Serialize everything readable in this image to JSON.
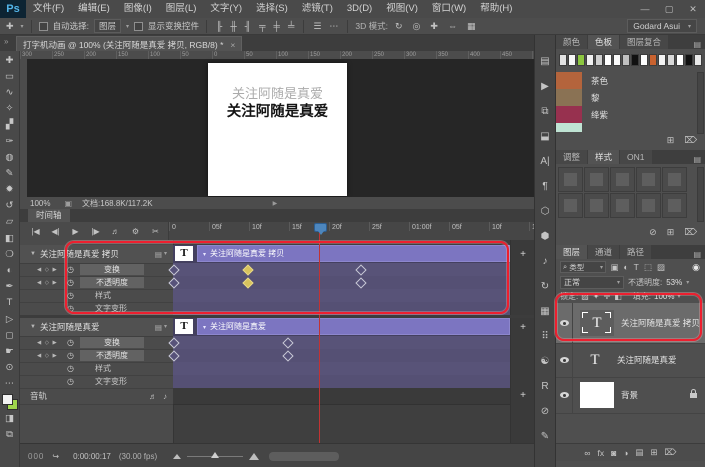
{
  "app": {
    "logo": "Ps",
    "window_controls": [
      {
        "g": "—"
      },
      {
        "g": "▢"
      },
      {
        "g": "✕"
      }
    ],
    "workspace": "Godard Asui",
    "collapse_glyph": "»"
  },
  "menubar": {
    "items": [
      {
        "label": "文件(F)"
      },
      {
        "label": "编辑(E)"
      },
      {
        "label": "图像(I)"
      },
      {
        "label": "图层(L)"
      },
      {
        "label": "文字(Y)"
      },
      {
        "label": "选择(S)"
      },
      {
        "label": "滤镜(T)"
      },
      {
        "label": "3D(D)"
      },
      {
        "label": "视图(V)"
      },
      {
        "label": "窗口(W)"
      },
      {
        "label": "帮助(H)"
      }
    ]
  },
  "options": {
    "tool_glyph": "✚",
    "auto_select_label": "自动选择:",
    "auto_select_value": "图层",
    "show_transform_label": "显示变换控件",
    "align_icons": [
      {
        "g": "╟"
      },
      {
        "g": "╫"
      },
      {
        "g": "╢"
      },
      {
        "g": "╤"
      },
      {
        "g": "╪"
      },
      {
        "g": "╧"
      }
    ],
    "dist_icons": [
      {
        "g": "☰"
      },
      {
        "g": "⋯"
      }
    ],
    "mode_label": "3D 模式:",
    "mode_icons": [
      {
        "g": "↻"
      },
      {
        "g": "◎"
      },
      {
        "g": "✚"
      },
      {
        "g": "⇔"
      },
      {
        "g": "▦"
      }
    ]
  },
  "tabbar": {
    "title": "打字机动画 @ 100% (关注阿随是真爱 拷贝, RGB/8) *",
    "close": "×"
  },
  "tools": [
    {
      "name": "move-tool-icon",
      "g": "✚"
    },
    {
      "name": "marquee-tool-icon",
      "g": "▭"
    },
    {
      "name": "lasso-tool-icon",
      "g": "∿"
    },
    {
      "name": "quick-selection-tool-icon",
      "g": "✧"
    },
    {
      "name": "crop-tool-icon",
      "g": "▞"
    },
    {
      "name": "eyedropper-tool-icon",
      "g": "✑"
    },
    {
      "name": "healing-brush-tool-icon",
      "g": "◍"
    },
    {
      "name": "brush-tool-icon",
      "g": "✎"
    },
    {
      "name": "clone-stamp-tool-icon",
      "g": "✹"
    },
    {
      "name": "history-brush-tool-icon",
      "g": "↺"
    },
    {
      "name": "eraser-tool-icon",
      "g": "▱"
    },
    {
      "name": "gradient-tool-icon",
      "g": "◧"
    },
    {
      "name": "blur-tool-icon",
      "g": "❍"
    },
    {
      "name": "dodge-tool-icon",
      "g": "◐"
    },
    {
      "name": "pen-tool-icon",
      "g": "✒"
    },
    {
      "name": "type-tool-icon",
      "g": "T"
    },
    {
      "name": "path-selection-tool-icon",
      "g": "▷"
    },
    {
      "name": "shape-tool-icon",
      "g": "◻"
    },
    {
      "name": "hand-tool-icon",
      "g": "☛"
    },
    {
      "name": "zoom-tool-icon",
      "g": "⊙"
    },
    {
      "name": "more-tools-icon",
      "g": "⋯"
    }
  ],
  "ruler": {
    "h_labels": [
      {
        "t": "300"
      },
      {
        "t": "250"
      },
      {
        "t": "200"
      },
      {
        "t": "150"
      },
      {
        "t": "100"
      },
      {
        "t": "50"
      },
      {
        "t": "0"
      },
      {
        "t": "50"
      },
      {
        "t": "100"
      },
      {
        "t": "150"
      },
      {
        "t": "200"
      },
      {
        "t": "250"
      },
      {
        "t": "300"
      },
      {
        "t": "350"
      },
      {
        "t": "400"
      },
      {
        "t": "450"
      },
      {
        "t": "500"
      }
    ]
  },
  "canvas": {
    "line1": "关注阿随是真爱",
    "line2": "关注阿随是真爱"
  },
  "statusbar": {
    "zoom": "100%",
    "doc_icon": "▣",
    "doc": "文档:168.8K/117.2K",
    "chevron": "▶"
  },
  "timeline": {
    "tab": "时间轴",
    "transport": [
      {
        "g": "|◀"
      },
      {
        "g": "◀|"
      },
      {
        "g": "▶"
      },
      {
        "g": "|▶"
      },
      {
        "g": "♬"
      },
      {
        "g": "⚙"
      },
      {
        "g": "✂"
      },
      {
        "g": "◪"
      }
    ],
    "ruler": [
      {
        "t": "0"
      },
      {
        "t": "05f"
      },
      {
        "t": "10f"
      },
      {
        "t": "15f"
      },
      {
        "t": "20f"
      },
      {
        "t": "25f"
      },
      {
        "t": "01:00f"
      },
      {
        "t": "05f"
      },
      {
        "t": "10f"
      },
      {
        "t": "15f"
      }
    ],
    "group_icon": "▤",
    "caret": "▼",
    "add": "+",
    "groups": [
      {
        "name": "关注阿随是真爱 拷贝",
        "clip": "关注阿随是真爱 拷贝",
        "thumb": "T",
        "rows": [
          {
            "label": "变换"
          },
          {
            "label": "不透明度"
          },
          {
            "label": "样式"
          },
          {
            "label": "文字变形"
          }
        ],
        "keys_transform": [
          {
            "css": "left:-3px",
            "cls": "kf"
          },
          {
            "css": "left:71px",
            "cls": "kf yellow"
          },
          {
            "css": "left:184px",
            "cls": "kf"
          }
        ],
        "keys_opacity": [
          {
            "css": "left:-3px",
            "cls": "kf"
          },
          {
            "css": "left:71px",
            "cls": "kf yellow"
          },
          {
            "css": "left:184px",
            "cls": "kf"
          }
        ]
      },
      {
        "name": "关注阿随是真爱",
        "clip": "关注阿随是真爱",
        "thumb": "T",
        "rows": [
          {
            "label": "变换"
          },
          {
            "label": "不透明度"
          },
          {
            "label": "样式"
          },
          {
            "label": "文字变形"
          }
        ],
        "keys_transform": [
          {
            "css": "left:-3px",
            "cls": "kf"
          },
          {
            "css": "left:111px",
            "cls": "kf"
          }
        ],
        "keys_opacity": [
          {
            "css": "left:-3px",
            "cls": "kf"
          },
          {
            "css": "left:111px",
            "cls": "kf"
          }
        ]
      }
    ],
    "audio_label": "音轨",
    "audio_icons": [
      {
        "g": "♬"
      },
      {
        "g": "♪"
      }
    ],
    "footer": {
      "frames": "000",
      "flip_icon": "↪",
      "timecode": "0:00:00:17",
      "fps": "(30.00 fps)"
    }
  },
  "dock_icons": [
    {
      "name": "dock-properties-icon",
      "g": "▤"
    },
    {
      "name": "dock-actions-icon",
      "g": "▶"
    },
    {
      "name": "dock-clone-source-icon",
      "g": "⧉"
    },
    {
      "name": "dock-histogram-icon",
      "g": "⬓"
    },
    {
      "name": "dock-character-icon",
      "g": "A|"
    },
    {
      "name": "dock-paragraph-icon",
      "g": "¶"
    },
    {
      "name": "dock-3d-icon",
      "g": "⬡"
    },
    {
      "name": "dock-3d-material-icon",
      "g": "⬢"
    },
    {
      "name": "dock-audio-icon",
      "g": "♪"
    },
    {
      "name": "dock-history-icon",
      "g": "↻"
    },
    {
      "name": "dock-channels-icon",
      "g": "▦"
    },
    {
      "name": "dock-brush-presets-icon",
      "g": "⠿"
    },
    {
      "name": "dock-balance-icon",
      "g": "☯"
    },
    {
      "name": "dock-camera-raw-icon",
      "g": "R"
    },
    {
      "name": "dock-no-icon",
      "g": "⊘"
    },
    {
      "name": "dock-notes-icon",
      "g": "✎"
    }
  ],
  "panels": {
    "swatches": {
      "tabs": {
        "t1": "颜色",
        "t2": "色板",
        "t3": "图层复合"
      },
      "strip": [
        {
          "css": "background:#e3e3e3"
        },
        {
          "css": "background:#f7f7f7"
        },
        {
          "css": "background:#8cc63f"
        },
        {
          "css": "background:#efefef"
        },
        {
          "css": "background:#cfcfcf"
        },
        {
          "css": "background:#ffffff"
        },
        {
          "css": "background:#fafafa"
        },
        {
          "css": "background:#bfbfbf"
        },
        {
          "css": "background:#111111"
        },
        {
          "css": "background:#ffffff"
        },
        {
          "css": "background:#c9622f"
        },
        {
          "css": "background:#f2f2f2"
        },
        {
          "css": "background:#d8d8d8"
        },
        {
          "css": "background:#ffffff"
        },
        {
          "css": "background:#101010"
        },
        {
          "css": "background:#e9e9e9"
        }
      ],
      "named": [
        {
          "name": "茶色",
          "css": "background:#b4643c"
        },
        {
          "name": "黎",
          "css": "background:#8a7254"
        },
        {
          "name": "绛紫",
          "css": "background:#97314f"
        },
        {
          "name": "",
          "css": "background:#bfe3d3"
        }
      ],
      "icons": [
        {
          "g": "⊞"
        },
        {
          "g": "⌦"
        }
      ]
    },
    "styles": {
      "tabs": {
        "t1": "调整",
        "t2": "样式",
        "t3": "ON1"
      },
      "cells": [
        {},
        {},
        {},
        {},
        {},
        {},
        {},
        {},
        {},
        {}
      ],
      "icons": [
        {
          "g": "⊘"
        },
        {
          "g": "⊞"
        },
        {
          "g": "⌦"
        }
      ]
    },
    "layers": {
      "tabs": {
        "t1": "图层",
        "t2": "通道",
        "t3": "路径"
      },
      "search_icon": "⌕",
      "filter_value": "类型",
      "filter_icons": [
        {
          "g": "▣"
        },
        {
          "g": "◐"
        },
        {
          "g": "T"
        },
        {
          "g": "⬚"
        },
        {
          "g": "▨"
        }
      ],
      "pin_icon": "◉",
      "blend_mode": "正常",
      "opacity_label": "不透明度:",
      "opacity_value": "53%",
      "lock_label": "锁定:",
      "lock_icons": [
        {
          "g": "▨"
        },
        {
          "g": "✦"
        },
        {
          "g": "✛"
        },
        {
          "g": "◧"
        }
      ],
      "fill_label": "填充:",
      "fill_value": "100%",
      "items": {
        "l1": "关注阿随是真爱 拷贝",
        "l2": "关注阿随是真爱",
        "l3": "背景",
        "thumb_glyph": "T"
      },
      "bottom_icons": [
        {
          "g": "∞"
        },
        {
          "g": "fx"
        },
        {
          "g": "◙"
        },
        {
          "g": "◑"
        },
        {
          "g": "▤"
        },
        {
          "g": "⊞"
        },
        {
          "g": "⌦"
        }
      ]
    }
  }
}
